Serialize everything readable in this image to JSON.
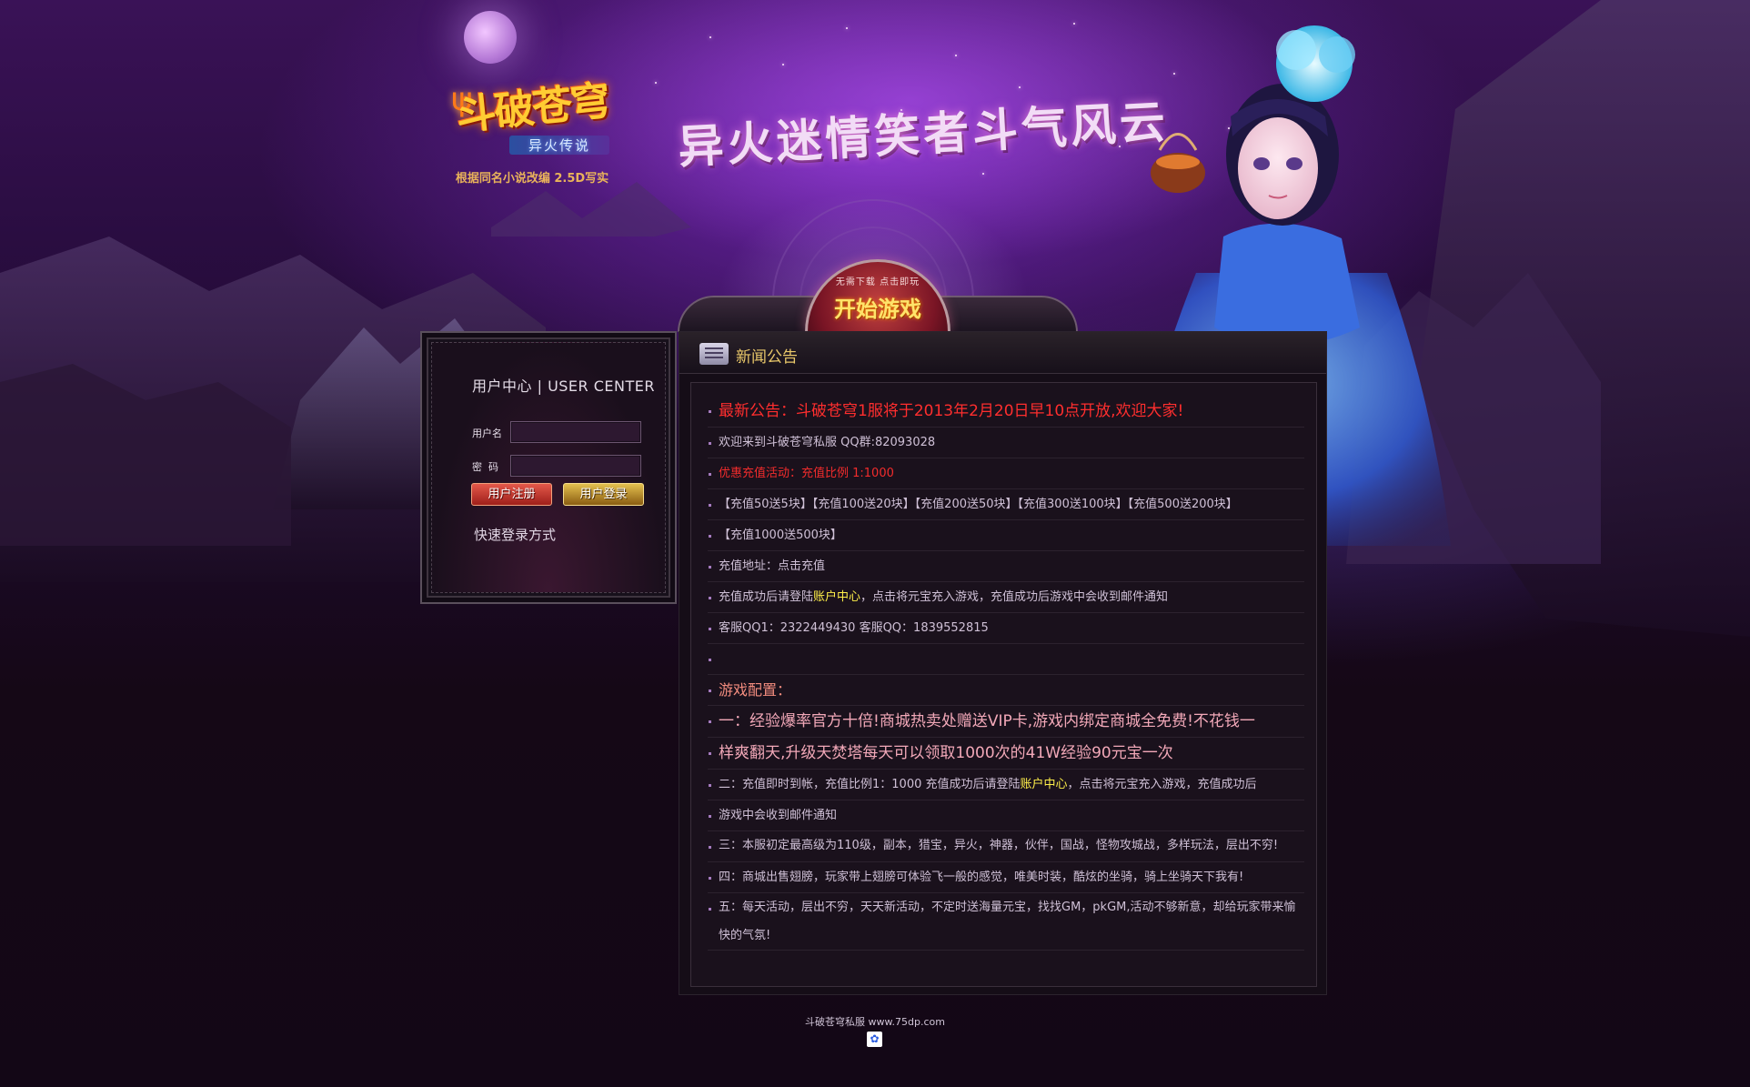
{
  "header": {
    "logo_title": "斗破苍穹",
    "logo_subtitle": "异火传说",
    "logo_tagline": "根据同名小说改编 2.5D写实",
    "slogan": "异火迷情笑者斗气风云",
    "start_button_small": "无需下载 点击即玩",
    "start_button_label": "开始游戏"
  },
  "user_center": {
    "title": "用户中心 | USER CENTER",
    "username_label": "用户名",
    "password_label": "密  码",
    "username_value": "",
    "password_value": "",
    "register_label": "用户注册",
    "login_label": "用户登录",
    "quick_login_label": "快速登录方式"
  },
  "news": {
    "title": "新闻公告",
    "headline": "最新公告：斗破苍穹1服将于2013年2月20日早10点开放,欢迎大家!",
    "welcome": "欢迎来到斗破苍穹私服 QQ群:82093028",
    "promo_title": "优惠充值活动：充值比例 1:1000",
    "promo_tiers": "【充值50送5块】【充值100送20块】【充值200送50块】【充值300送100块】【充值500送200块】",
    "promo_tier_last": "【充值1000送500块】",
    "recharge_address": "充值地址：点击充值",
    "after_recharge_prefix": "充值成功后请登陆",
    "account_center_link": "账户中心",
    "after_recharge_suffix": "，点击将元宝充入游戏，充值成功后游戏中会收到邮件通知",
    "customer_service": "客服QQ1：2322449430 客服QQ：1839552815",
    "config_title": "游戏配置：",
    "config_1a": "一：经验爆率官方十倍!商城热卖处赠送VIP卡,游戏内绑定商城全免费!不花钱一",
    "config_1b": "样爽翻天,升级天焚塔每天可以领取1000次的41W经验90元宝一次",
    "config_2_prefix": "二：充值即时到帐，充值比例1：1000 充值成功后请登陆",
    "config_2_link": "账户中心",
    "config_2_suffix": "，点击将元宝充入游戏，充值成功后",
    "config_2b": "游戏中会收到邮件通知",
    "config_3": "三：本服初定最高级为110级，副本，猎宝，异火，神器，伙伴，国战，怪物攻城战，多样玩法，层出不穷!",
    "config_4": "四：商城出售翅膀，玩家带上翅膀可体验飞一般的感觉，唯美时装，酷炫的坐骑，骑上坐骑天下我有!",
    "config_5": "五：每天活动，层出不穷，天天新活动，不定时送海量元宝，找找GM，pkGM,活动不够新意，却给玩家带来愉快的气氛!"
  },
  "footer": {
    "text": "斗破苍穹私服 www.75dp.com",
    "icon": "paw-icon"
  },
  "colors": {
    "background": "#150816",
    "accent_gold": "#e9c86a",
    "headline_red": "#ff2e2e",
    "link_yellow": "#fff04a"
  }
}
